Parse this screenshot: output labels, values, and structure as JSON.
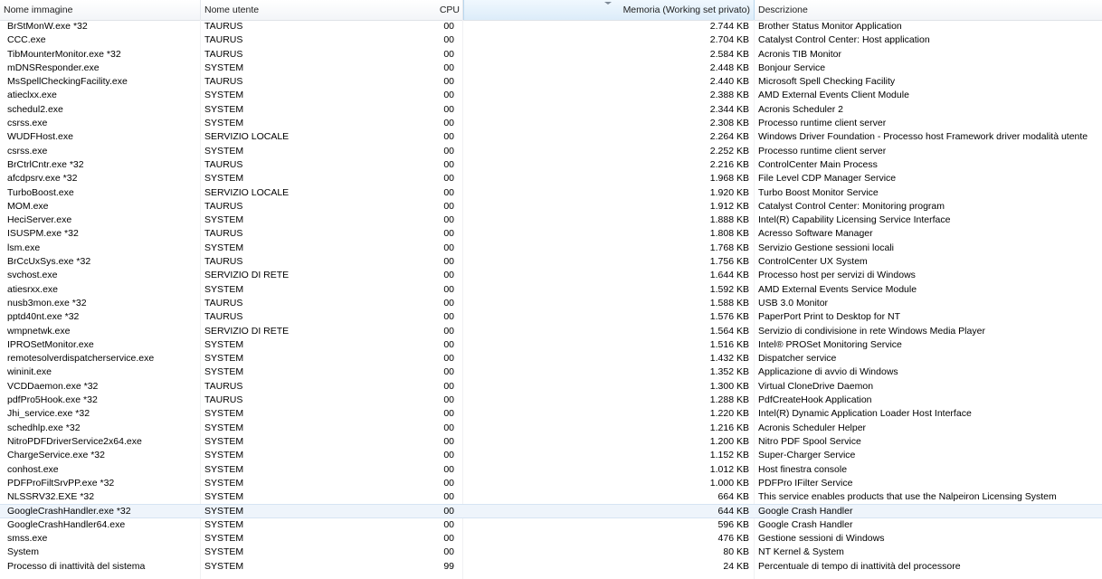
{
  "table": {
    "headers": {
      "name": "Nome immagine",
      "user": "Nome utente",
      "cpu": "CPU",
      "memory": "Memoria (Working set privato)",
      "description": "Descrizione"
    },
    "sorted_column": "memory",
    "selected_row_index": 35,
    "rows": [
      {
        "name": "BrStMonW.exe *32",
        "user": "TAURUS",
        "cpu": "00",
        "memory": "2.744 KB",
        "description": "Brother Status Monitor Application"
      },
      {
        "name": "CCC.exe",
        "user": "TAURUS",
        "cpu": "00",
        "memory": "2.704 KB",
        "description": "Catalyst Control Center: Host application"
      },
      {
        "name": "TibMounterMonitor.exe *32",
        "user": "TAURUS",
        "cpu": "00",
        "memory": "2.584 KB",
        "description": "Acronis TIB Monitor"
      },
      {
        "name": "mDNSResponder.exe",
        "user": "SYSTEM",
        "cpu": "00",
        "memory": "2.448 KB",
        "description": "Bonjour Service"
      },
      {
        "name": "MsSpellCheckingFacility.exe",
        "user": "TAURUS",
        "cpu": "00",
        "memory": "2.440 KB",
        "description": "Microsoft Spell Checking Facility"
      },
      {
        "name": "atieclxx.exe",
        "user": "SYSTEM",
        "cpu": "00",
        "memory": "2.388 KB",
        "description": "AMD External Events Client Module"
      },
      {
        "name": "schedul2.exe",
        "user": "SYSTEM",
        "cpu": "00",
        "memory": "2.344 KB",
        "description": "Acronis Scheduler 2"
      },
      {
        "name": "csrss.exe",
        "user": "SYSTEM",
        "cpu": "00",
        "memory": "2.308 KB",
        "description": "Processo runtime client server"
      },
      {
        "name": "WUDFHost.exe",
        "user": "SERVIZIO LOCALE",
        "cpu": "00",
        "memory": "2.264 KB",
        "description": "Windows Driver Foundation - Processo host Framework driver modalità utente"
      },
      {
        "name": "csrss.exe",
        "user": "SYSTEM",
        "cpu": "00",
        "memory": "2.252 KB",
        "description": "Processo runtime client server"
      },
      {
        "name": "BrCtrlCntr.exe *32",
        "user": "TAURUS",
        "cpu": "00",
        "memory": "2.216 KB",
        "description": "ControlCenter Main Process"
      },
      {
        "name": "afcdpsrv.exe *32",
        "user": "SYSTEM",
        "cpu": "00",
        "memory": "1.968 KB",
        "description": "File Level CDP Manager Service"
      },
      {
        "name": "TurboBoost.exe",
        "user": "SERVIZIO LOCALE",
        "cpu": "00",
        "memory": "1.920 KB",
        "description": "Turbo Boost Monitor Service"
      },
      {
        "name": "MOM.exe",
        "user": "TAURUS",
        "cpu": "00",
        "memory": "1.912 KB",
        "description": "Catalyst Control Center: Monitoring program"
      },
      {
        "name": "HeciServer.exe",
        "user": "SYSTEM",
        "cpu": "00",
        "memory": "1.888 KB",
        "description": "Intel(R) Capability Licensing Service Interface"
      },
      {
        "name": "ISUSPM.exe *32",
        "user": "TAURUS",
        "cpu": "00",
        "memory": "1.808 KB",
        "description": "Acresso Software Manager"
      },
      {
        "name": "lsm.exe",
        "user": "SYSTEM",
        "cpu": "00",
        "memory": "1.768 KB",
        "description": "Servizio Gestione sessioni locali"
      },
      {
        "name": "BrCcUxSys.exe *32",
        "user": "TAURUS",
        "cpu": "00",
        "memory": "1.756 KB",
        "description": "ControlCenter UX System"
      },
      {
        "name": "svchost.exe",
        "user": "SERVIZIO DI RETE",
        "cpu": "00",
        "memory": "1.644 KB",
        "description": "Processo host per servizi di Windows"
      },
      {
        "name": "atiesrxx.exe",
        "user": "SYSTEM",
        "cpu": "00",
        "memory": "1.592 KB",
        "description": "AMD External Events Service Module"
      },
      {
        "name": "nusb3mon.exe *32",
        "user": "TAURUS",
        "cpu": "00",
        "memory": "1.588 KB",
        "description": "USB 3.0 Monitor"
      },
      {
        "name": "pptd40nt.exe *32",
        "user": "TAURUS",
        "cpu": "00",
        "memory": "1.576 KB",
        "description": "PaperPort Print to Desktop for NT"
      },
      {
        "name": "wmpnetwk.exe",
        "user": "SERVIZIO DI RETE",
        "cpu": "00",
        "memory": "1.564 KB",
        "description": "Servizio di condivisione in rete Windows Media Player"
      },
      {
        "name": "IPROSetMonitor.exe",
        "user": "SYSTEM",
        "cpu": "00",
        "memory": "1.516 KB",
        "description": "Intel® PROSet Monitoring Service"
      },
      {
        "name": "remotesolverdispatcherservice.exe",
        "user": "SYSTEM",
        "cpu": "00",
        "memory": "1.432 KB",
        "description": "Dispatcher service"
      },
      {
        "name": "wininit.exe",
        "user": "SYSTEM",
        "cpu": "00",
        "memory": "1.352 KB",
        "description": "Applicazione di avvio di Windows"
      },
      {
        "name": "VCDDaemon.exe *32",
        "user": "TAURUS",
        "cpu": "00",
        "memory": "1.300 KB",
        "description": "Virtual CloneDrive Daemon"
      },
      {
        "name": "pdfPro5Hook.exe *32",
        "user": "TAURUS",
        "cpu": "00",
        "memory": "1.288 KB",
        "description": "PdfCreateHook Application"
      },
      {
        "name": "Jhi_service.exe *32",
        "user": "SYSTEM",
        "cpu": "00",
        "memory": "1.220 KB",
        "description": "Intel(R) Dynamic Application Loader Host Interface"
      },
      {
        "name": "schedhlp.exe *32",
        "user": "SYSTEM",
        "cpu": "00",
        "memory": "1.216 KB",
        "description": "Acronis Scheduler Helper"
      },
      {
        "name": "NitroPDFDriverService2x64.exe",
        "user": "SYSTEM",
        "cpu": "00",
        "memory": "1.200 KB",
        "description": "Nitro PDF Spool Service"
      },
      {
        "name": "ChargeService.exe *32",
        "user": "SYSTEM",
        "cpu": "00",
        "memory": "1.152 KB",
        "description": "Super-Charger Service"
      },
      {
        "name": "conhost.exe",
        "user": "SYSTEM",
        "cpu": "00",
        "memory": "1.012 KB",
        "description": "Host finestra console"
      },
      {
        "name": "PDFProFiltSrvPP.exe *32",
        "user": "SYSTEM",
        "cpu": "00",
        "memory": "1.000 KB",
        "description": "PDFPro IFilter Service"
      },
      {
        "name": "NLSSRV32.EXE *32",
        "user": "SYSTEM",
        "cpu": "00",
        "memory": "664 KB",
        "description": "This service enables products that use the Nalpeiron Licensing System"
      },
      {
        "name": "GoogleCrashHandler.exe *32",
        "user": "SYSTEM",
        "cpu": "00",
        "memory": "644 KB",
        "description": "Google Crash Handler"
      },
      {
        "name": "GoogleCrashHandler64.exe",
        "user": "SYSTEM",
        "cpu": "00",
        "memory": "596 KB",
        "description": "Google Crash Handler"
      },
      {
        "name": "smss.exe",
        "user": "SYSTEM",
        "cpu": "00",
        "memory": "476 KB",
        "description": "Gestione sessioni di Windows"
      },
      {
        "name": "System",
        "user": "SYSTEM",
        "cpu": "00",
        "memory": "80 KB",
        "description": "NT Kernel & System"
      },
      {
        "name": "Processo di inattività del sistema",
        "user": "SYSTEM",
        "cpu": "99",
        "memory": "24 KB",
        "description": "Percentuale di tempo di inattività del processore"
      }
    ]
  }
}
